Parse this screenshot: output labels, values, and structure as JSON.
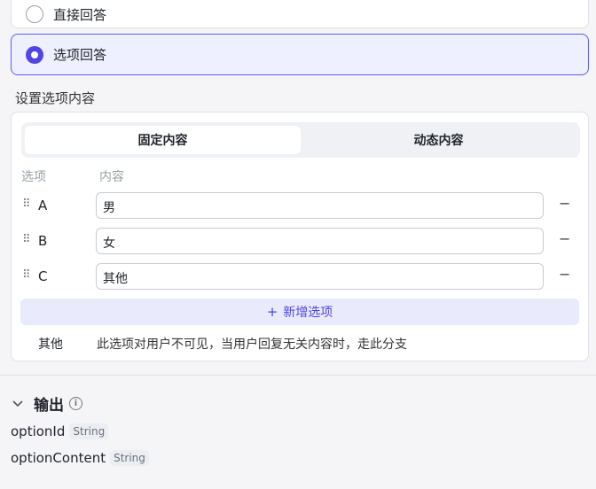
{
  "response_mode": {
    "direct": {
      "label": "直接回答",
      "selected": false
    },
    "options": {
      "label": "选项回答",
      "selected": true
    }
  },
  "options_section": {
    "title": "设置选项内容",
    "tabs": [
      {
        "label": "固定内容",
        "active": true
      },
      {
        "label": "动态内容",
        "active": false
      }
    ],
    "columns": {
      "option": "选项",
      "content": "内容"
    },
    "rows": [
      {
        "key": "A",
        "value": "男"
      },
      {
        "key": "B",
        "value": "女"
      },
      {
        "key": "C",
        "value": "其他"
      }
    ],
    "add_label": "新增选项",
    "other": {
      "key": "其他",
      "description": "此选项对用户不可见，当用户回复无关内容时，走此分支"
    }
  },
  "output": {
    "title": "输出",
    "fields": [
      {
        "name": "optionId",
        "type": "String"
      },
      {
        "name": "optionContent",
        "type": "String"
      }
    ]
  },
  "colors": {
    "accent": "#5146e5",
    "selected_bg": "#eef0ff",
    "add_bg": "#e9ebfd"
  }
}
